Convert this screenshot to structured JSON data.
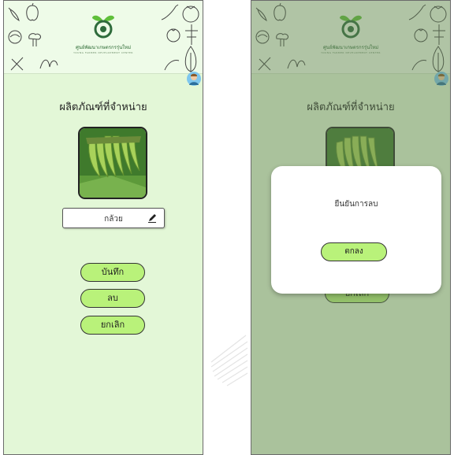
{
  "left_screen": {
    "logo": {
      "name_th": "ศูนย์พัฒนาเกษตรกรรุ่นใหม่",
      "name_en": "YOUNG FARMER DEVELOPMENT CENTER"
    },
    "title": "ผลิตภัณฑ์ที่จำหน่าย",
    "product_name": "กล้วย",
    "buttons": {
      "save": "บันทึก",
      "delete": "ลบ",
      "cancel": "ยกเลิก"
    }
  },
  "right_screen": {
    "logo": {
      "name_th": "ศูนย์พัฒนาเกษตรกรรุ่นใหม่",
      "name_en": "YOUNG FARMER DEVELOPMENT CENTER"
    },
    "title": "ผลิตภัณฑ์ที่จำหน่าย",
    "behind_button": "ยกเลิก",
    "dialog": {
      "message": "ยืนยันการลบ",
      "ok": "ตกลง"
    }
  },
  "colors": {
    "background": "#e3f7d7",
    "button": "#b9f27a",
    "overlay": "#8aa77e"
  }
}
